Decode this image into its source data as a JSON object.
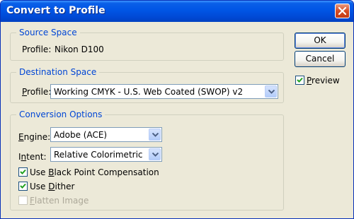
{
  "window": {
    "title": "Convert to Profile"
  },
  "source_space": {
    "legend": "Source Space",
    "profile_label": "Profile:",
    "profile_value": "Nikon D100"
  },
  "destination_space": {
    "legend": "Destination Space",
    "profile_label_u": "P",
    "profile_label_rest": "rofile:",
    "profile_value": "Working CMYK - U.S. Web Coated (SWOP) v2"
  },
  "conversion_options": {
    "legend": "Conversion Options",
    "engine_label_u": "E",
    "engine_label_rest": "ngine:",
    "engine_value": "Adobe (ACE)",
    "intent_label_pre": "I",
    "intent_label_u": "n",
    "intent_label_rest": "tent:",
    "intent_value": "Relative Colorimetric",
    "bpc_pre": "Use ",
    "bpc_u": "B",
    "bpc_rest": "lack Point Compensation",
    "bpc_checked": true,
    "dither_pre": "Use ",
    "dither_u": "D",
    "dither_rest": "ither",
    "dither_checked": true,
    "flatten_u": "F",
    "flatten_rest": "latten Image",
    "flatten_checked": false
  },
  "buttons": {
    "ok": "OK",
    "cancel": "Cancel"
  },
  "preview": {
    "u": "P",
    "rest": "review",
    "checked": true
  },
  "colors": {
    "legend_blue": "#0046d5",
    "window_bg": "#ece9d8",
    "titlebar": "#0055e5"
  },
  "icons": {
    "close": "close-icon",
    "dropdown": "chevron-down-icon",
    "check": "checkmark-icon"
  }
}
